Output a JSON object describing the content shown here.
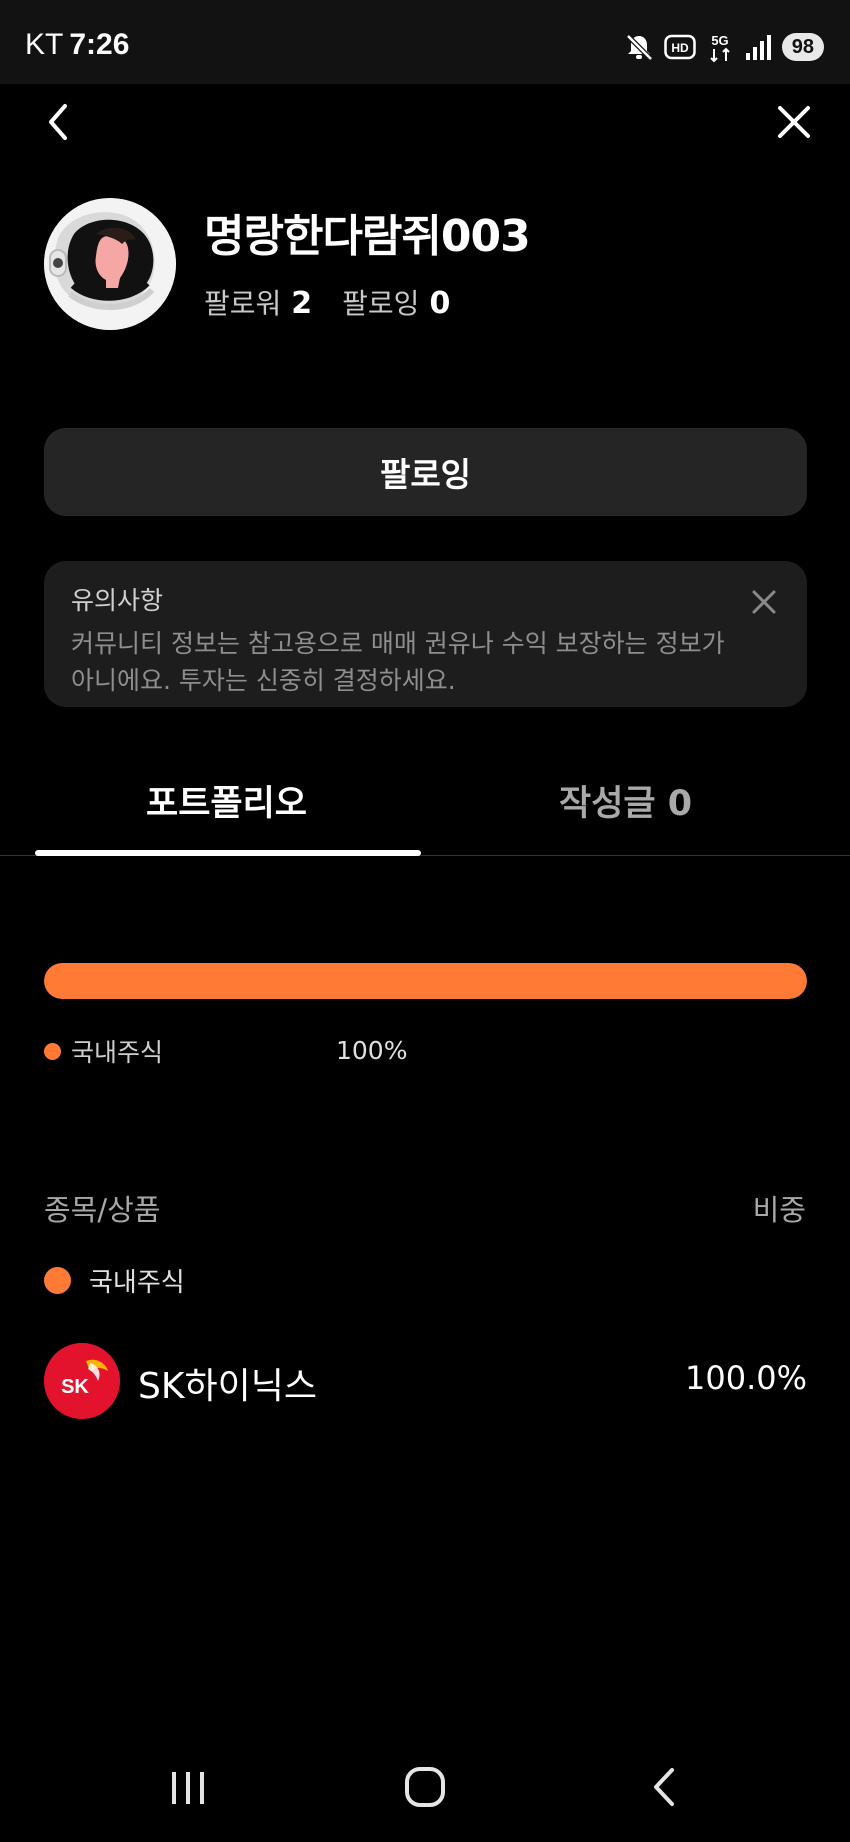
{
  "status_bar": {
    "carrier": "KT",
    "time": "7:26",
    "battery": "98",
    "icons": [
      "mute-icon",
      "hd-icon",
      "5g-icon",
      "signal-icon",
      "battery-icon"
    ]
  },
  "nav": {
    "back_icon": "chevron-left-icon",
    "close_icon": "close-icon"
  },
  "profile": {
    "username": "명랑한다람쥐003",
    "followers_label": "팔로워",
    "followers_count": "2",
    "following_label": "팔로잉",
    "following_count": "0",
    "follow_button_label": "팔로잉"
  },
  "notice": {
    "title": "유의사항",
    "body": "커뮤니티 정보는 참고용으로 매매 권유나 수익 보장하는 정보가 아니에요. 투자는 신중히 결정하세요."
  },
  "tabs": [
    {
      "label": "포트폴리오",
      "active": true
    },
    {
      "label": "작성글 0",
      "active": false
    }
  ],
  "allocation": {
    "legend_label": "국내주식",
    "legend_percent": "100%",
    "fill_fraction": 1.0,
    "color": "#ff7a35"
  },
  "holdings": {
    "header_left": "종목/상품",
    "header_right": "비중",
    "group_label": "국내주식",
    "items": [
      {
        "logo_text": "SK",
        "name": "SK하이닉스",
        "weight": "100.0%"
      }
    ]
  },
  "colors": {
    "background": "#000000",
    "accent": "#ff7a35",
    "sk_red": "#e3122d"
  }
}
